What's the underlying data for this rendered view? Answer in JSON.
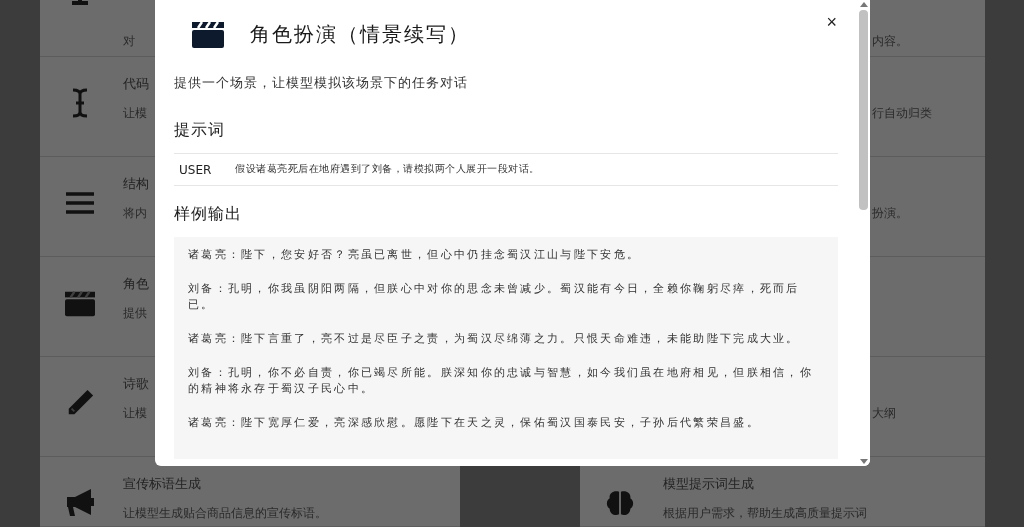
{
  "background_rows": [
    {
      "left": {
        "kind": "cut",
        "description": "对"
      },
      "right": {
        "description": "内容。"
      }
    },
    {
      "left": {
        "kind": "cursor",
        "title": "代码",
        "description": "让模"
      },
      "right": {
        "description": "行自动归类"
      }
    },
    {
      "left": {
        "kind": "lines",
        "title": "结构",
        "description": "将内"
      },
      "right": {
        "description": "扮演。"
      }
    },
    {
      "left": {
        "kind": "clapper",
        "title": "角色",
        "description": "提供"
      }
    },
    {
      "left": {
        "kind": "pencil",
        "title": "诗歌",
        "description": "让模"
      },
      "right": {
        "description": "大纲"
      }
    },
    {
      "left": {
        "kind": "megaphone",
        "title": "宣传标语生成",
        "description": "让模型生成贴合商品信息的宣传标语。"
      },
      "right": {
        "kind": "brain",
        "title": "模型提示词生成",
        "description": "根据用户需求，帮助生成高质量提示词"
      }
    }
  ],
  "modal": {
    "title": "角色扮演（情景续写）",
    "close": "×",
    "description": "提供一个场景，让模型模拟该场景下的任务对话",
    "prompt_heading": "提示词",
    "prompt": {
      "role": "USER",
      "text": "假设诸葛亮死后在地府遇到了刘备，请模拟两个人展开一段对话。"
    },
    "output_heading": "样例输出",
    "output": [
      "诸葛亮：陛下，您安好否？亮虽已离世，但心中仍挂念蜀汉江山与陛下安危。",
      "刘备：孔明，你我虽阴阳两隔，但朕心中对你的思念未曾减少。蜀汉能有今日，全赖你鞠躬尽瘁，死而后已。",
      "诸葛亮：陛下言重了，亮不过是尽臣子之责，为蜀汉尽绵薄之力。只恨天命难违，未能助陛下完成大业。",
      "刘备：孔明，你不必自责，你已竭尽所能。朕深知你的忠诚与智慧，如今我们虽在地府相见，但朕相信，你的精神将永存于蜀汉子民心中。",
      "诸葛亮：陛下宽厚仁爱，亮深感欣慰。愿陛下在天之灵，保佑蜀汉国泰民安，子孙后代繁荣昌盛。"
    ]
  }
}
